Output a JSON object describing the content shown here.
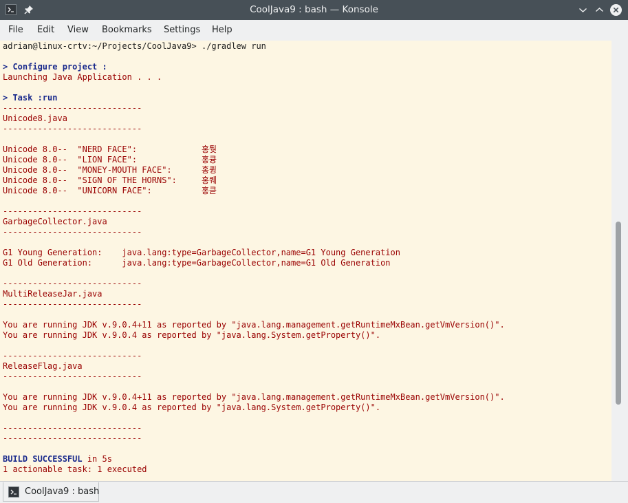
{
  "window": {
    "title": "CoolJava9 : bash — Konsole"
  },
  "icons": {
    "app": "terminal-icon",
    "pin": "pin-icon",
    "minimize": "chevron-down-icon",
    "maximize": "chevron-up-icon",
    "close": "close-icon"
  },
  "menu": {
    "file": "File",
    "edit": "Edit",
    "view": "View",
    "bookmarks": "Bookmarks",
    "settings": "Settings",
    "help": "Help"
  },
  "terminal": {
    "lines": [
      {
        "text": "adrian@linux-crtv:~/Projects/CoolJava9> ./gradlew run",
        "style": "prompt"
      },
      {
        "text": "",
        "style": "normal"
      },
      {
        "text": "> Configure project :",
        "style": "bold"
      },
      {
        "text": "Launching Java Application . . .",
        "style": "normal"
      },
      {
        "text": "",
        "style": "normal"
      },
      {
        "text": "> Task :run",
        "style": "bold"
      },
      {
        "text": "----------------------------",
        "style": "normal"
      },
      {
        "text": "Unicode8.java",
        "style": "normal"
      },
      {
        "text": "----------------------------",
        "style": "normal"
      },
      {
        "text": "",
        "style": "normal"
      },
      {
        "text": "Unicode 8.0--  \"NERD FACE\":             홍퉛",
        "style": "normal"
      },
      {
        "text": "Unicode 8.0--  \"LION FACE\":             홍큥",
        "style": "normal"
      },
      {
        "text": "Unicode 8.0--  \"MONEY-MOUTH FACE\":      홍큉",
        "style": "normal"
      },
      {
        "text": "Unicode 8.0--  \"SIGN OF THE HORNS\":     홍퀘",
        "style": "normal"
      },
      {
        "text": "Unicode 8.0--  \"UNICORN FACE\":          홍큳",
        "style": "normal"
      },
      {
        "text": "",
        "style": "normal"
      },
      {
        "text": "----------------------------",
        "style": "normal"
      },
      {
        "text": "GarbageCollector.java",
        "style": "normal"
      },
      {
        "text": "----------------------------",
        "style": "normal"
      },
      {
        "text": "",
        "style": "normal"
      },
      {
        "text": "G1 Young Generation:    java.lang:type=GarbageCollector,name=G1 Young Generation",
        "style": "normal"
      },
      {
        "text": "G1 Old Generation:      java.lang:type=GarbageCollector,name=G1 Old Generation",
        "style": "normal"
      },
      {
        "text": "",
        "style": "normal"
      },
      {
        "text": "----------------------------",
        "style": "normal"
      },
      {
        "text": "MultiReleaseJar.java",
        "style": "normal"
      },
      {
        "text": "----------------------------",
        "style": "normal"
      },
      {
        "text": "",
        "style": "normal"
      },
      {
        "text": "You are running JDK v.9.0.4+11 as reported by \"java.lang.management.getRuntimeMxBean.getVmVersion()\".",
        "style": "normal"
      },
      {
        "text": "You are running JDK v.9.0.4 as reported by \"java.lang.System.getProperty()\".",
        "style": "normal"
      },
      {
        "text": "",
        "style": "normal"
      },
      {
        "text": "----------------------------",
        "style": "normal"
      },
      {
        "text": "ReleaseFlag.java",
        "style": "normal"
      },
      {
        "text": "----------------------------",
        "style": "normal"
      },
      {
        "text": "",
        "style": "normal"
      },
      {
        "text": "You are running JDK v.9.0.4+11 as reported by \"java.lang.management.getRuntimeMxBean.getVmVersion()\".",
        "style": "normal"
      },
      {
        "text": "You are running JDK v.9.0.4 as reported by \"java.lang.System.getProperty()\".",
        "style": "normal"
      },
      {
        "text": "",
        "style": "normal"
      },
      {
        "text": "----------------------------",
        "style": "normal"
      },
      {
        "text": "----------------------------",
        "style": "normal"
      },
      {
        "text": "",
        "style": "normal"
      },
      {
        "text": "BUILD SUCCESSFUL in 5s",
        "style": "build"
      },
      {
        "text": "1 actionable task: 1 executed",
        "style": "normal"
      }
    ]
  },
  "tabs": [
    {
      "label": "CoolJava9 : bash"
    }
  ],
  "colors": {
    "titlebar": "#475057",
    "terminal_bg": "#fdf6e3",
    "text": "#990000",
    "bold_text": "#1a2a8c"
  }
}
